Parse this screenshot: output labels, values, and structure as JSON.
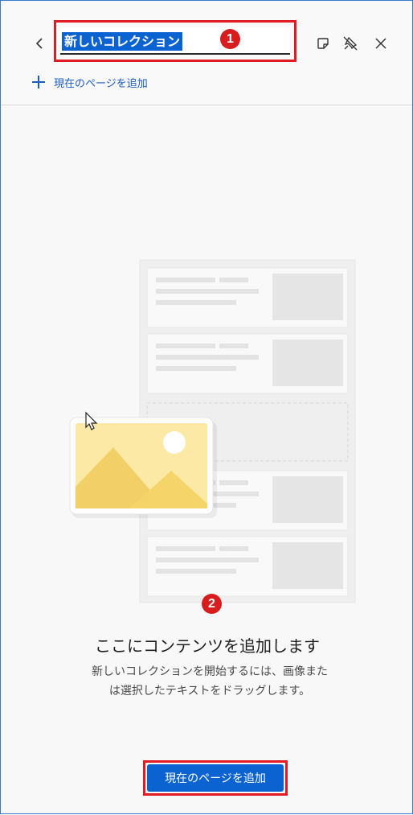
{
  "header": {
    "collection_title": "新しいコレクション",
    "add_current_page_link": "現在のページを追加",
    "icons": {
      "back": "chevron-left-icon",
      "note": "sticky-note-icon",
      "unpin": "unpin-icon",
      "close": "close-icon"
    }
  },
  "markers": {
    "first": "1",
    "second": "2"
  },
  "empty_state": {
    "heading": "ここにコンテンツを追加します",
    "description": "新しいコレクションを開始するには、画像または選択したテキストをドラッグします。",
    "button_label": "現在のページを追加"
  },
  "colors": {
    "accent": "#0b63d1",
    "annotation": "#e01b24",
    "link": "#1a5ac3",
    "illustration_yellow": "#f5d56a"
  }
}
